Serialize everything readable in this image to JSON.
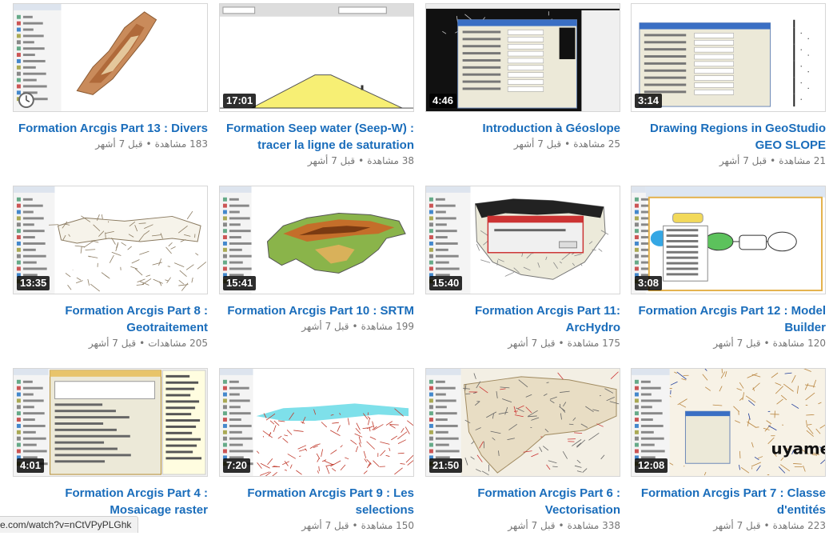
{
  "status_bar": {
    "url": "e.com/watch?v=nCtVPyPLGhk"
  },
  "colors": {
    "title": "#1a6dbb",
    "meta": "#767676",
    "duration_bg": "#000000"
  },
  "videos": [
    {
      "thumb_style": "map-relief",
      "duration": "",
      "clock_icon": "clock-icon",
      "title": "Formation Arcgis Part 13 : Divers",
      "views": "183 مشاهدة",
      "age": "قبل 7 أشهر"
    },
    {
      "thumb_style": "dam-profile",
      "duration": "17:01",
      "title": "Formation Seep water (Seep-W) : tracer la ligne de saturation",
      "views": "38 مشاهدة",
      "age": "قبل 7 أشهر"
    },
    {
      "thumb_style": "dialog-dark",
      "duration": "4:46",
      "title": "Introduction à Géoslope",
      "views": "25 مشاهدة",
      "age": "قبل 7 أشهر"
    },
    {
      "thumb_style": "dialog-light",
      "duration": "3:14",
      "title": "Drawing Regions in GeoStudio GEO SLOPE",
      "views": "21 مشاهدة",
      "age": "قبل 7 أشهر"
    },
    {
      "thumb_style": "map-network",
      "duration": "13:35",
      "title": "Formation Arcgis Part 8 : Geotraitement",
      "views": "205 مشاهدات",
      "age": "قبل 7 أشهر"
    },
    {
      "thumb_style": "map-srtm",
      "duration": "15:41",
      "title": "Formation Arcgis Part 10 : SRTM",
      "views": "199 مشاهدة",
      "age": "قبل 7 أشهر"
    },
    {
      "thumb_style": "map-hydro",
      "duration": "15:40",
      "title": "Formation Arcgis Part 11: ArcHydro",
      "views": "175 مشاهدة",
      "age": "قبل 7 أشهر"
    },
    {
      "thumb_style": "model-builder",
      "duration": "3:08",
      "title": "Formation Arcgis Part 12 : Model Builder",
      "views": "120 مشاهدة",
      "age": "قبل 7 أشهر"
    },
    {
      "thumb_style": "mosaic-dialog",
      "duration": "4:01",
      "title": "Formation Arcgis Part 4 : Mosaicage raster",
      "views": "",
      "age": ""
    },
    {
      "thumb_style": "map-selection",
      "duration": "7:20",
      "title": "Formation Arcgis Part 9 : Les selections",
      "views": "150 مشاهدة",
      "age": "قبل 7 أشهر"
    },
    {
      "thumb_style": "map-vector",
      "duration": "21:50",
      "title": "Formation Arcgis Part 6 : Vectorisation",
      "views": "338 مشاهدة",
      "age": "قبل 7 أشهر"
    },
    {
      "thumb_style": "map-topo",
      "duration": "12:08",
      "title": "Formation Arcgis Part 7 : Classe d'entités",
      "views": "223 مشاهدة",
      "age": "قبل 7 أشهر"
    }
  ]
}
